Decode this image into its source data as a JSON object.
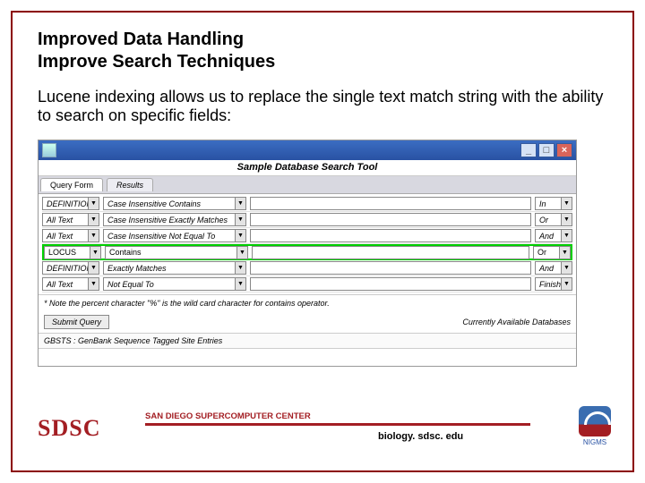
{
  "slide": {
    "title_line1": "Improved Data Handling",
    "title_line2": "Improve Search Techniques",
    "description": "Lucene indexing allows us to replace the single text match string with the ability to search on specific fields:"
  },
  "app": {
    "window_title": "Sample Database Search Tool",
    "tabs": {
      "active": "Query Form",
      "other": "Results"
    },
    "rows": [
      {
        "field": "DEFINITION",
        "op": "Case Insensitive Contains",
        "conn": "In"
      },
      {
        "field": "All Text",
        "op": "Case Insensitive Exactly Matches",
        "conn": "Or"
      },
      {
        "field": "All Text",
        "op": "Case Insensitive Not Equal To",
        "conn": "And"
      },
      {
        "field": "LOCUS",
        "op": "Contains",
        "conn": "Or"
      },
      {
        "field": "DEFINITION",
        "op": "Exactly Matches",
        "conn": "And"
      },
      {
        "field": "All Text",
        "op": "Not Equal To",
        "conn": "Finished"
      }
    ],
    "note": "* Note the percent character \"%\" is the wild card character for contains operator.",
    "submit_label": "Submit Query",
    "available_label": "Currently Available Databases",
    "db_entry": "GBSTS : GenBank Sequence Tagged Site Entries"
  },
  "footer": {
    "logo_text": "SDSC",
    "org": "SAN DIEGO SUPERCOMPUTER CENTER",
    "url": "biology. sdsc. edu",
    "right_org": "NIGMS"
  }
}
